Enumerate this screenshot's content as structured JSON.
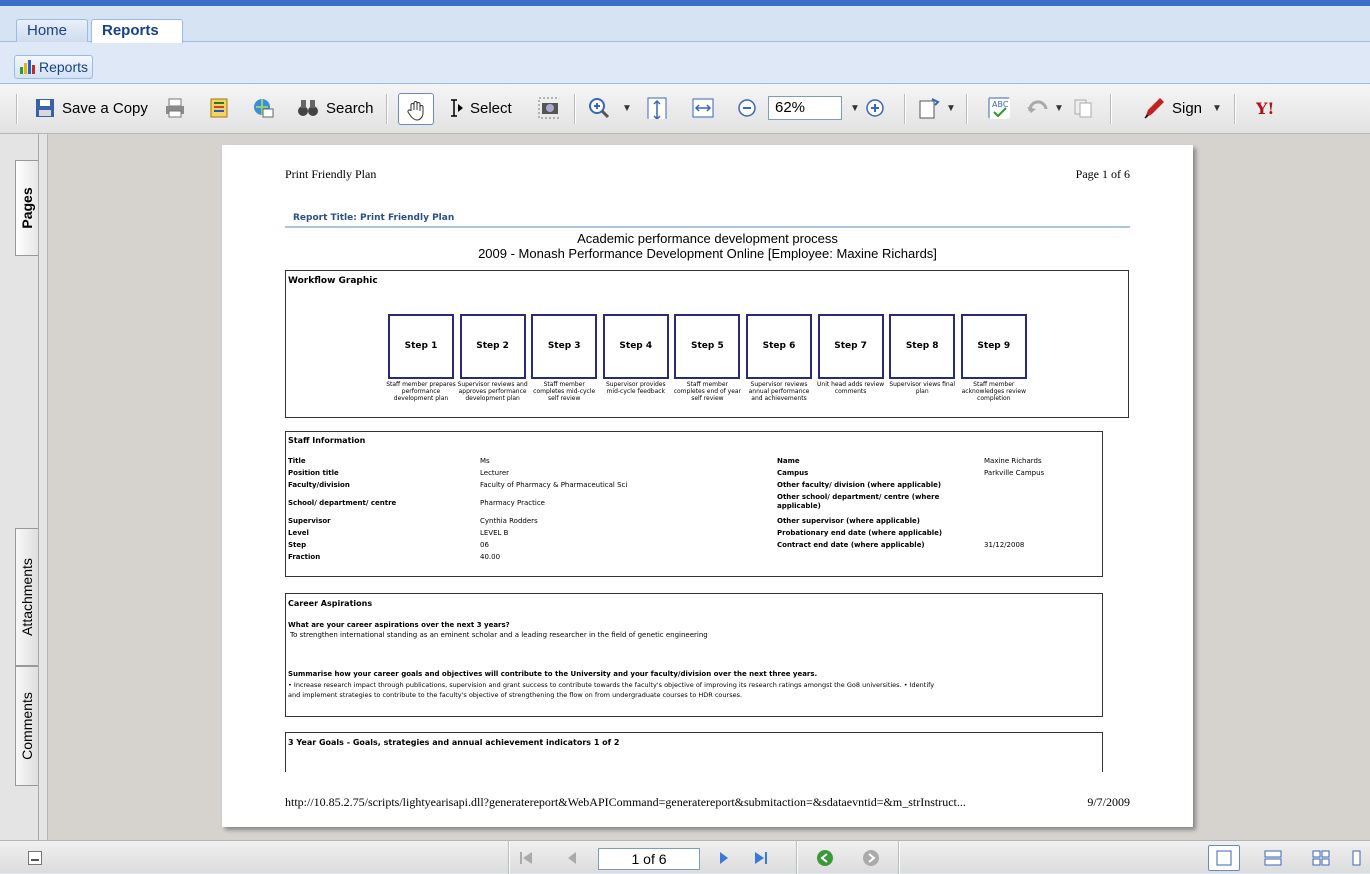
{
  "tabs": {
    "home": "Home",
    "reports": "Reports"
  },
  "reports_button": "Reports",
  "toolbar": {
    "save_copy": "Save a Copy",
    "search": "Search",
    "select": "Select",
    "zoom": "62%",
    "sign": "Sign"
  },
  "page": {
    "header_left": "Print Friendly Plan",
    "header_right": "Page 1 of 6",
    "report_title": "Report Title: Print Friendly Plan",
    "heading1": "Academic performance development process",
    "heading2": "2009 - Monash Performance Development Online [Employee: Maxine Richards]",
    "workflow_title": "Workflow Graphic",
    "steps": [
      {
        "label": "Step 1",
        "desc": "Staff member prepares performance development plan"
      },
      {
        "label": "Step 2",
        "desc": "Supervisor reviews and approves performance development plan"
      },
      {
        "label": "Step 3",
        "desc": "Staff member completes mid-cycle self review"
      },
      {
        "label": "Step 4",
        "desc": "Supervisor provides mid-cycle feedback"
      },
      {
        "label": "Step 5",
        "desc": "Staff member completes end of year self review"
      },
      {
        "label": "Step 6",
        "desc": "Supervisor reviews annual performance and achievements"
      },
      {
        "label": "Step 7",
        "desc": "Unit head adds review comments"
      },
      {
        "label": "Step 8",
        "desc": "Supervisor views final plan"
      },
      {
        "label": "Step 9",
        "desc": "Staff member acknowledges review completion"
      }
    ],
    "staff_title": "Staff Information",
    "staff_left": [
      {
        "k": "Title",
        "v": "Ms"
      },
      {
        "k": "Position title",
        "v": "Lecturer"
      },
      {
        "k": "Faculty/division",
        "v": "Faculty of Pharmacy & Pharmaceutical Sci"
      },
      {
        "k": "School/ department/ centre",
        "v": "Pharmacy Practice"
      },
      {
        "k": "Supervisor",
        "v": "Cynthia Rodders"
      },
      {
        "k": "Level",
        "v": "LEVEL B"
      },
      {
        "k": "Step",
        "v": "06"
      },
      {
        "k": "Fraction",
        "v": "40.00"
      }
    ],
    "staff_right": [
      {
        "k": "Name",
        "v": "Maxine Richards"
      },
      {
        "k": "Campus",
        "v": "Parkville Campus"
      },
      {
        "k": "Other faculty/ division (where applicable)",
        "v": ""
      },
      {
        "k": "Other school/ department/ centre (where applicable)",
        "v": ""
      },
      {
        "k": "Other supervisor (where applicable)",
        "v": ""
      },
      {
        "k": "Probationary end date (where applicable)",
        "v": ""
      },
      {
        "k": "Contract end date (where applicable)",
        "v": "31/12/2008"
      }
    ],
    "career_title": "Career Aspirations",
    "career_q1": "What are your career aspirations over the next 3 years?",
    "career_a1": "To strengthen international standing as an eminent scholar and a leading researcher in the field of genetic engineering",
    "career_q2": "Summarise how your career goals and objectives will contribute to the University and your faculty/division over the next three years.",
    "career_a2a": "• Increase research impact through publications, supervision and grant success to contribute towards the faculty's objective of improving its research ratings amongst the Go8 universities. • Identify",
    "career_a2b": "and implement strategies to contribute to the faculty's objective of strengthening the flow on from undergraduate courses to HDR courses.",
    "goals_title": "3 Year Goals - Goals, strategies and annual achievement indicators 1 of 2",
    "footer_url": "http://10.85.2.75/scripts/lightyearisapi.dll?generatereport&WebAPICommand=generatereport&submitaction=&sdataevntid=&m_strInstruct...",
    "footer_date": "9/7/2009"
  },
  "sidebar": {
    "pages": "Pages",
    "attachments": "Attachments",
    "comments": "Comments"
  },
  "status": {
    "page_of": "1 of 6"
  }
}
